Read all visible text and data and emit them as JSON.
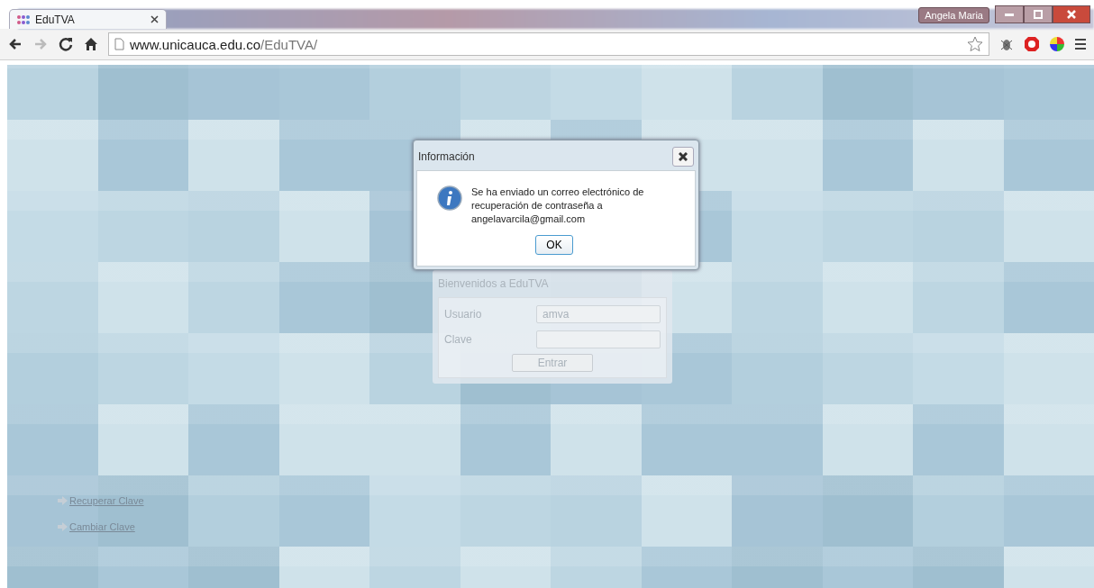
{
  "browser": {
    "tab_title": "EduTVA",
    "url_host": "www.unicauca.edu.co",
    "url_path": "/EduTVA/",
    "profile": "Angela Maria"
  },
  "login": {
    "heading": "Bienvenidos a EduTVA",
    "fields": [
      {
        "label": "Usuario",
        "value": "amva"
      },
      {
        "label": "Clave"
      }
    ],
    "button": "Entrar"
  },
  "links": [
    "Recuperar Clave",
    "Cambiar Clave"
  ],
  "dialog": {
    "title": "Información",
    "message": "Se ha enviado un correo electrónico de recuperación de contraseña a angelavarcila@gmail.com",
    "button": "OK"
  }
}
